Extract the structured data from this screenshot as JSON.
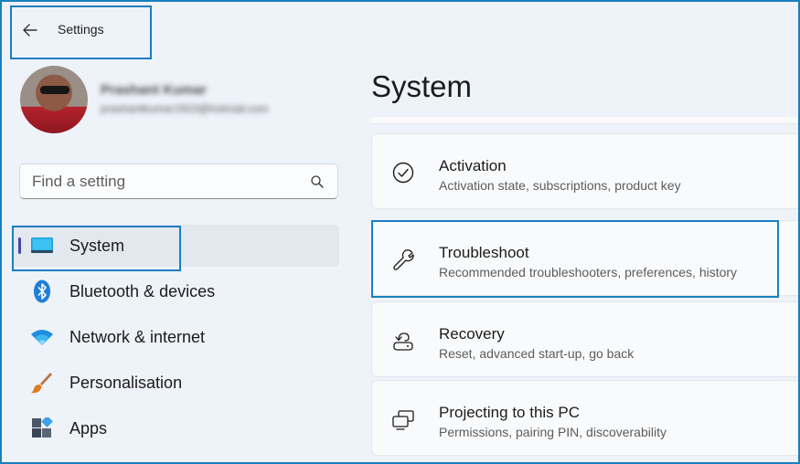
{
  "window": {
    "title": "Settings",
    "back_icon": "back-arrow-icon"
  },
  "profile": {
    "name": "Prashant Kumar",
    "email": "prashantkumar1910@hotmail.com"
  },
  "search": {
    "placeholder": "Find a setting",
    "value": "",
    "icon": "search-icon"
  },
  "sidebar": {
    "items": [
      {
        "label": "System",
        "icon": "monitor-icon",
        "active": true
      },
      {
        "label": "Bluetooth & devices",
        "icon": "bluetooth-icon",
        "active": false
      },
      {
        "label": "Network & internet",
        "icon": "wifi-icon",
        "active": false
      },
      {
        "label": "Personalisation",
        "icon": "paintbrush-icon",
        "active": false
      },
      {
        "label": "Apps",
        "icon": "apps-icon",
        "active": false
      }
    ]
  },
  "main": {
    "title": "System",
    "cards": [
      {
        "title": "Activation",
        "subtitle": "Activation state, subscriptions, product key",
        "icon": "check-circle-icon"
      },
      {
        "title": "Troubleshoot",
        "subtitle": "Recommended troubleshooters, preferences, history",
        "icon": "wrench-icon"
      },
      {
        "title": "Recovery",
        "subtitle": "Reset, advanced start-up, go back",
        "icon": "recovery-icon"
      },
      {
        "title": "Projecting to this PC",
        "subtitle": "Permissions, pairing PIN, discoverability",
        "icon": "projecting-icon"
      }
    ]
  },
  "colors": {
    "accent": "#1a7fbf",
    "background": "#eef2f9",
    "nav_indicator": "#3f4aa8"
  }
}
